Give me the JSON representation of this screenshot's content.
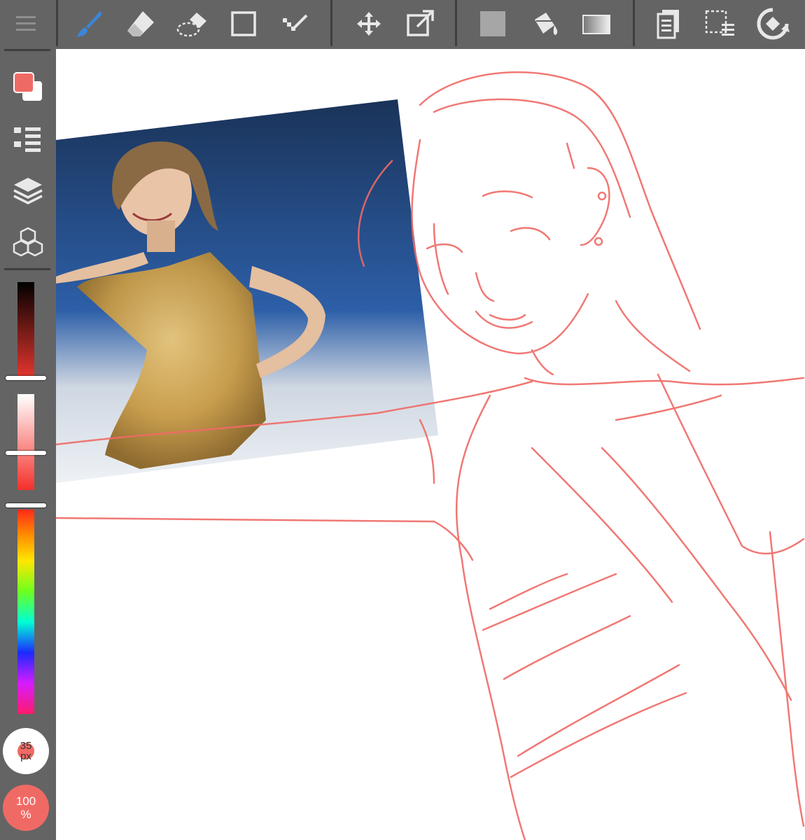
{
  "toolbar": {
    "items": [
      {
        "name": "menu-icon"
      },
      {
        "name": "brush-tool-icon",
        "active": true
      },
      {
        "name": "eraser-tool-icon"
      },
      {
        "name": "selection-eraser-icon"
      },
      {
        "name": "rectangle-tool-icon"
      },
      {
        "name": "magic-wand-icon"
      },
      {
        "name": "move-tool-icon"
      },
      {
        "name": "transform-tool-icon"
      },
      {
        "name": "fill-color-icon"
      },
      {
        "name": "bucket-tool-icon"
      },
      {
        "name": "gradient-tool-icon"
      },
      {
        "name": "material-icon"
      },
      {
        "name": "select-layer-icon"
      },
      {
        "name": "rotate-canvas-icon"
      }
    ]
  },
  "sidebar": {
    "color_primary": "#f06a65",
    "color_secondary": "#ffffff",
    "items": [
      {
        "name": "color-swap-icon"
      },
      {
        "name": "brush-list-icon"
      },
      {
        "name": "layers-icon"
      },
      {
        "name": "materials-icon"
      }
    ]
  },
  "brush": {
    "size_label": "35 px",
    "opacity_label": "100 %",
    "color": "#f06a65"
  },
  "colors": {
    "accent": "#3a86d8",
    "panel": "#646464",
    "sketch": "#ef6a66"
  }
}
